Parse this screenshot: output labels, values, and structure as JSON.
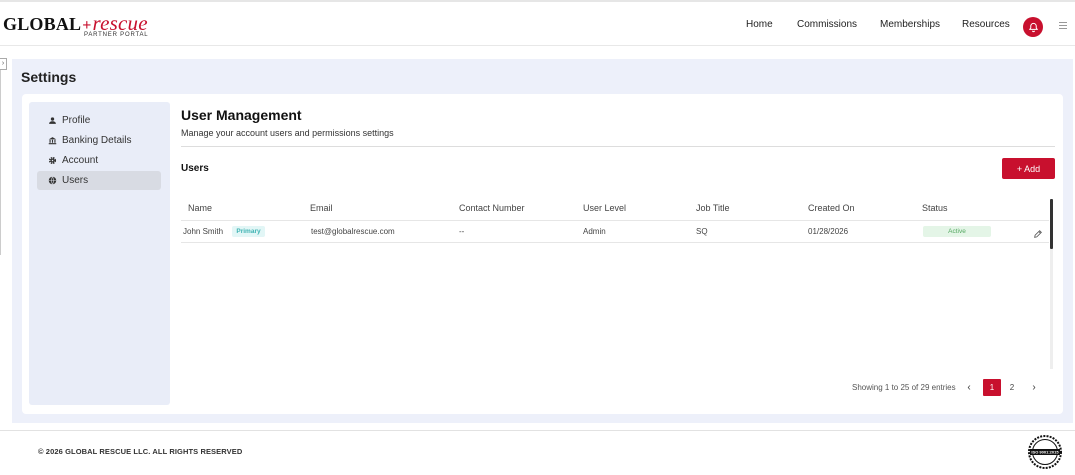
{
  "header": {
    "logo_left": "GLOBAL",
    "logo_right": "rescue",
    "logo_sub": "PARTNER PORTAL",
    "nav": [
      "Home",
      "Commissions",
      "Memberships",
      "Resources"
    ]
  },
  "page": {
    "title": "Settings"
  },
  "sidebar": {
    "items": [
      {
        "label": "Profile",
        "icon": "person-icon"
      },
      {
        "label": "Banking Details",
        "icon": "bank-icon"
      },
      {
        "label": "Account",
        "icon": "gear-icon"
      },
      {
        "label": "Users",
        "icon": "globe-icon",
        "active": true
      }
    ]
  },
  "user_management": {
    "title": "User Management",
    "subtitle": "Manage your account users and permissions settings",
    "section_title": "Users",
    "add_label": "+ Add"
  },
  "table": {
    "columns": [
      "Name",
      "Email",
      "Contact Number",
      "User Level",
      "Job Title",
      "Created On",
      "Status"
    ],
    "rows": [
      {
        "name": "John Smith",
        "badge": "Primary",
        "email": "test@globalrescue.com",
        "contact": "--",
        "level": "Admin",
        "job": "SQ",
        "created": "01/28/2026",
        "status": "Active"
      }
    ]
  },
  "pagination": {
    "summary": "Showing 1 to 25 of 29 entries",
    "pages": [
      "1",
      "2"
    ],
    "current": "1"
  },
  "footer": {
    "copyright": "© 2026 GLOBAL RESCUE LLC. ALL RIGHTS RESERVED",
    "iso": "ISO 9001:2015"
  },
  "colors": {
    "accent": "#c8102e",
    "panel_bg": "#edf0fa",
    "sidebar_bg": "#e9edf8"
  }
}
